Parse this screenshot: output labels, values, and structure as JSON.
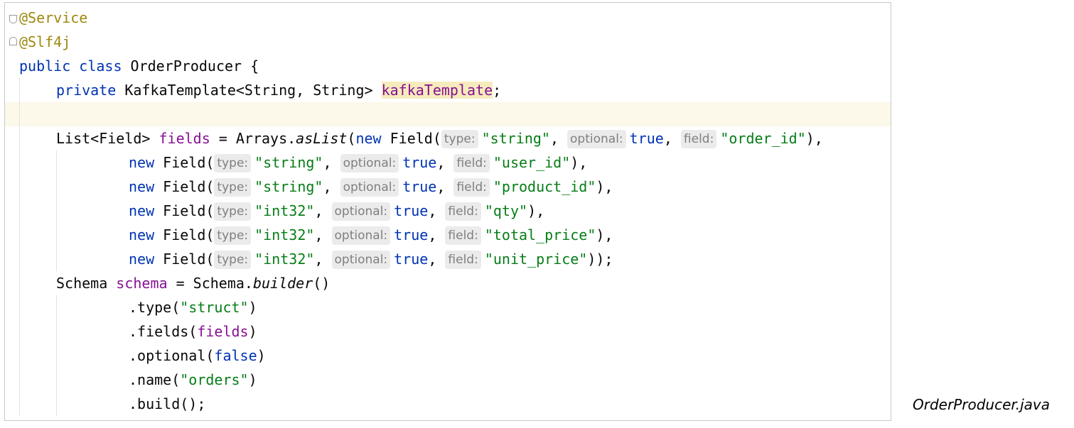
{
  "editor": {
    "file_caption": "OrderProducer.java",
    "code": {
      "annotation_service": "@Service",
      "annotation_slf4j": "@Slf4j",
      "class_decl": {
        "kw_public": "public",
        "kw_class": "class",
        "rest": " OrderProducer {"
      },
      "field_decl": {
        "kw_private": "private",
        "type": " KafkaTemplate<String, String> ",
        "name": "kafkaTemplate",
        "end": ";"
      },
      "list_decl": {
        "type": "List<Field> ",
        "name": "fields",
        "eq": " = Arrays.",
        "method": "asList",
        "paren": "("
      },
      "kw_new": "new",
      "field_ctor": " Field(",
      "hints": {
        "type": "type:",
        "optional": "optional:",
        "field": "field:"
      },
      "comma": ",",
      "kw_true": "true",
      "fields": [
        {
          "type": "\"string\"",
          "field": "\"order_id\"",
          "end": "),"
        },
        {
          "type": "\"string\"",
          "field": "\"user_id\"",
          "end": "),"
        },
        {
          "type": "\"string\"",
          "field": "\"product_id\"",
          "end": "),"
        },
        {
          "type": "\"int32\"",
          "field": "\"qty\"",
          "end": "),"
        },
        {
          "type": "\"int32\"",
          "field": "\"total_price\"",
          "end": "),"
        },
        {
          "type": "\"int32\"",
          "field": "\"unit_price\"",
          "end": "));"
        }
      ],
      "schema_decl": {
        "type": "Schema ",
        "name": "schema",
        "eq": " = Schema.",
        "method": "builder",
        "paren": "()"
      },
      "builder_chain": {
        "type_call": ".type(",
        "type_arg": "\"struct\"",
        "fields_call": ".fields(",
        "fields_arg": "fields",
        "optional_call": ".optional(",
        "optional_arg": "false",
        "name_call": ".name(",
        "name_arg": "\"orders\"",
        "close": ")",
        "build": ".build();"
      }
    }
  }
}
